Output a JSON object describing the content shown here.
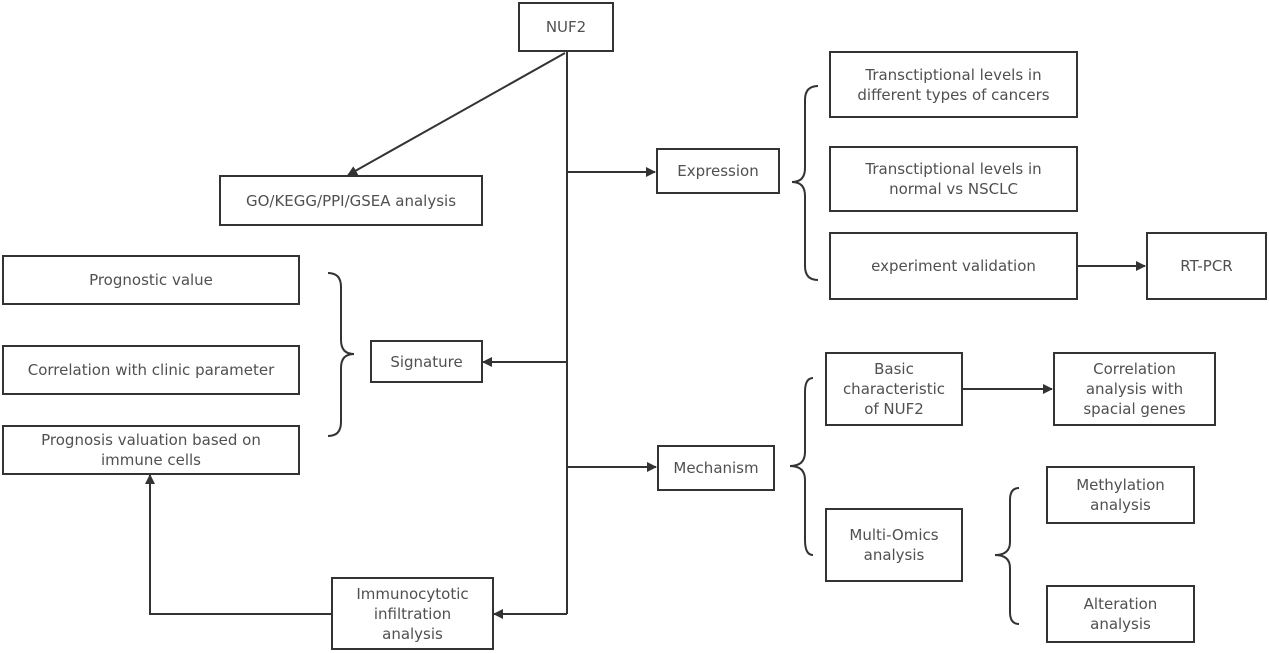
{
  "diagram": {
    "root": {
      "id": "nuf2",
      "label": "NUF2"
    },
    "nodes": {
      "nuf2": "NUF2",
      "go": "GO/KEGG/PPI/GSEA analysis",
      "expression": "Expression",
      "trans_cancers": "Transctiptional levels in\ndifferent types of cancers",
      "trans_nsclc": "Transctiptional levels in\nnormal vs NSCLC",
      "experiment": "experiment validation",
      "rtpcr": "RT-PCR",
      "prognostic": "Prognostic value",
      "clinic": "Correlation with clinic parameter",
      "prognosis_immune": "Prognosis valuation  based on\nimmune cells",
      "signature": "Signature",
      "mechanism": "Mechanism",
      "basic": "Basic\ncharacteristic\nof NUF2",
      "correlation": "Correlation\nanalysis with\nspacial genes",
      "multiomics": "Multi-Omics\nanalysis",
      "methylation": "Methylation\nanalysis",
      "alteration": "Alteration\nanalysis",
      "immuno": "Immunocytotic\ninfiltration\nanalysis"
    },
    "edges": [
      {
        "from": "nuf2",
        "to": "go",
        "type": "arrow"
      },
      {
        "from": "nuf2",
        "to": "expression",
        "type": "arrow"
      },
      {
        "from": "nuf2",
        "to": "signature",
        "type": "arrow"
      },
      {
        "from": "nuf2",
        "to": "mechanism",
        "type": "arrow"
      },
      {
        "from": "nuf2",
        "to": "immuno",
        "type": "arrow"
      },
      {
        "from": "experiment",
        "to": "rtpcr",
        "type": "arrow"
      },
      {
        "from": "basic",
        "to": "correlation",
        "type": "arrow"
      },
      {
        "from": "immuno",
        "to": "prognosis_immune",
        "type": "arrow"
      },
      {
        "from": "expression",
        "to": [
          "trans_cancers",
          "trans_nsclc",
          "experiment"
        ],
        "type": "brace"
      },
      {
        "from": "signature",
        "to": [
          "prognostic",
          "clinic",
          "prognosis_immune"
        ],
        "type": "brace"
      },
      {
        "from": "mechanism",
        "to": [
          "basic",
          "multiomics"
        ],
        "type": "brace"
      },
      {
        "from": "multiomics",
        "to": [
          "methylation",
          "alteration"
        ],
        "type": "brace"
      }
    ],
    "colors": {
      "stroke": "#333333",
      "text": "#505050",
      "background": "#ffffff"
    }
  }
}
